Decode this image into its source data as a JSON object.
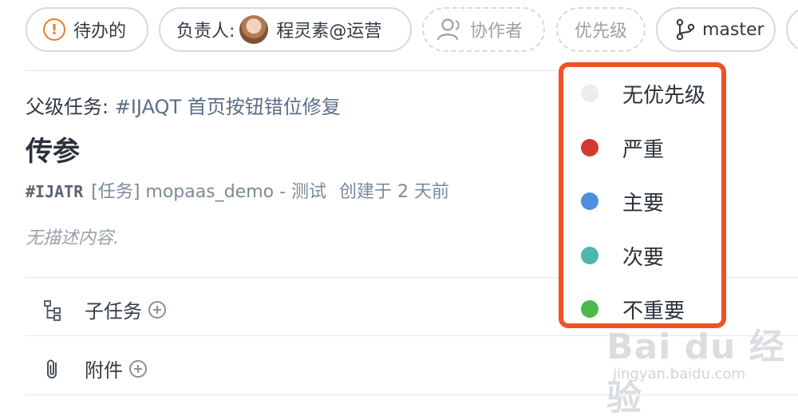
{
  "toolbar": {
    "status_label": "待办的",
    "status_icon": "alert-circle-icon",
    "assignee_label": "负责人:",
    "assignee_name": "程灵素@运营",
    "collaborators_label": "协作者",
    "priority_label": "优先级",
    "branch_label": "master"
  },
  "task": {
    "parent_prefix": "父级任务: ",
    "parent_ref": "#IJAQT 首页按钮错位修复",
    "title": "传参",
    "code": "#IJATR",
    "type_project": "[任务] mopaas_demo - 测试",
    "created": "创建于 2 天前",
    "description": "无描述内容."
  },
  "sections": {
    "subtasks_label": "子任务",
    "attachments_label": "附件"
  },
  "priority_dropdown": {
    "options": [
      {
        "label": "无优先级",
        "color": "#ececec"
      },
      {
        "label": "严重",
        "color": "#d33a2f"
      },
      {
        "label": "主要",
        "color": "#4f8fe0"
      },
      {
        "label": "次要",
        "color": "#4cb7ad"
      },
      {
        "label": "不重要",
        "color": "#4cb94f"
      }
    ],
    "highlight_color": "#ee5326"
  },
  "watermark": {
    "brand": "Bai du 经验",
    "url": "jingyan.baidu.com"
  }
}
